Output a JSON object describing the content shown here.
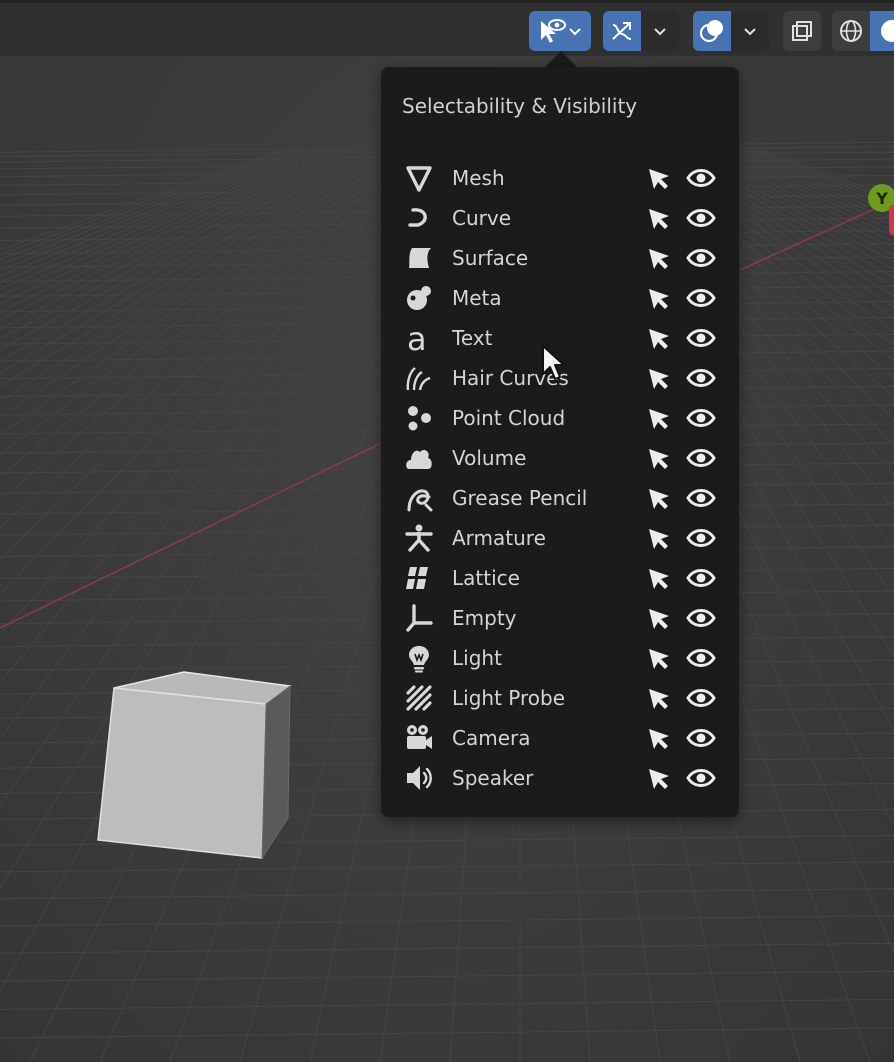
{
  "header": {
    "buttons": [
      {
        "name": "selectability-visibility",
        "icon": "eye-arrow-icon",
        "active": true,
        "has_dropdown": true
      },
      {
        "name": "gizmo",
        "icon": "gizmo-icon",
        "active": true,
        "has_dropdown": true
      },
      {
        "name": "overlays",
        "icon": "overlays-icon",
        "active": true,
        "has_dropdown": true
      },
      {
        "name": "xray",
        "icon": "xray-toggle-icon",
        "active": false,
        "has_dropdown": false
      },
      {
        "name": "wireframe-shading",
        "icon": "wireframe-sphere-icon",
        "active": false,
        "has_dropdown": false
      },
      {
        "name": "solid-shading",
        "icon": "solid-sphere-icon",
        "active": true,
        "has_dropdown": false
      }
    ]
  },
  "popover": {
    "title": "Selectability & Visibility",
    "rows": [
      {
        "label": "Mesh",
        "icon": "mesh-icon",
        "selectable": true,
        "visible": true
      },
      {
        "label": "Curve",
        "icon": "curve-icon",
        "selectable": true,
        "visible": true
      },
      {
        "label": "Surface",
        "icon": "surface-icon",
        "selectable": true,
        "visible": true
      },
      {
        "label": "Meta",
        "icon": "meta-icon",
        "selectable": true,
        "visible": true
      },
      {
        "label": "Text",
        "icon": "text-icon",
        "selectable": true,
        "visible": true
      },
      {
        "label": "Hair Curves",
        "icon": "hair-curves-icon",
        "selectable": true,
        "visible": true
      },
      {
        "label": "Point Cloud",
        "icon": "point-cloud-icon",
        "selectable": true,
        "visible": true
      },
      {
        "label": "Volume",
        "icon": "volume-icon",
        "selectable": true,
        "visible": true
      },
      {
        "label": "Grease Pencil",
        "icon": "grease-pencil-icon",
        "selectable": true,
        "visible": true
      },
      {
        "label": "Armature",
        "icon": "armature-icon",
        "selectable": true,
        "visible": true
      },
      {
        "label": "Lattice",
        "icon": "lattice-icon",
        "selectable": true,
        "visible": true
      },
      {
        "label": "Empty",
        "icon": "empty-icon",
        "selectable": true,
        "visible": true
      },
      {
        "label": "Light",
        "icon": "light-icon",
        "selectable": true,
        "visible": true
      },
      {
        "label": "Light Probe",
        "icon": "light-probe-icon",
        "selectable": true,
        "visible": true
      },
      {
        "label": "Camera",
        "icon": "camera-icon",
        "selectable": true,
        "visible": true
      },
      {
        "label": "Speaker",
        "icon": "speaker-icon",
        "selectable": true,
        "visible": true
      }
    ]
  },
  "viewport": {
    "gizmo_y_label": "Y"
  },
  "colors": {
    "active_button": "#4772b3",
    "popover_bg": "#1b1b1b",
    "icon": "#d8d8d8",
    "axis_y": "#6e9a1f",
    "axis_x": "#c8394a"
  }
}
